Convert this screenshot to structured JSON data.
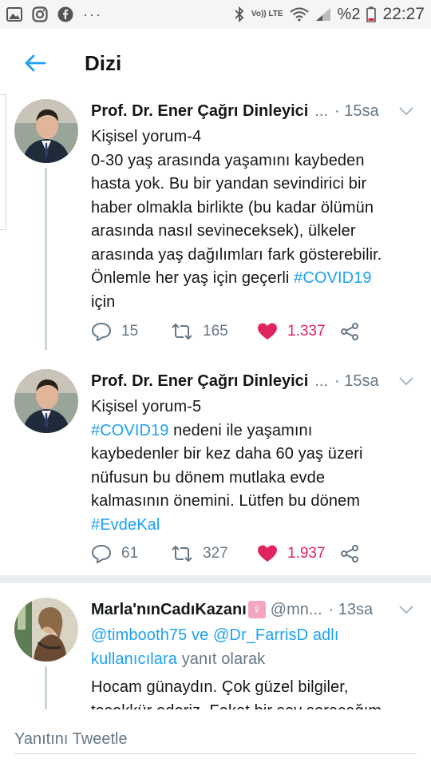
{
  "status_bar": {
    "icons_left": [
      "gallery-icon",
      "instagram-icon",
      "facebook-icon"
    ],
    "more": "···",
    "volte": "Vo)) LTE",
    "battery_pct": "%2",
    "time": "22:27"
  },
  "header": {
    "title": "Dizi"
  },
  "tweets": [
    {
      "author": "Prof. Dr. Ener Çağrı Dinleyici",
      "ellipsis": "...",
      "time": "· 15sa",
      "lines": [
        "Kişisel yorum-4",
        "0-30 yaş arasında yaşamını kaybeden",
        "hasta yok. Bu bir yandan sevindirici bir",
        "haber olmakla birlikte (bu kadar ölümün",
        "arasında nasıl sevineceksek), ülkeler",
        "arasında yaş dağılımları fark gösterebilir.",
        "Önlemle her yaş için geçerli "
      ],
      "hashtag": "#COVID19",
      "last_line": "için",
      "replies": "15",
      "retweets": "165",
      "likes": "1.337"
    },
    {
      "author": "Prof. Dr. Ener Çağrı Dinleyici",
      "ellipsis": "...",
      "time": "· 15sa",
      "line1": "Kişisel yorum-5",
      "hashtag1": "#COVID19",
      "line2_rest": " nedeni ile yaşamını",
      "line3": "kaybedenler bir kez daha 60 yaş üzeri",
      "line4": "nüfusun bu dönem mutlaka evde",
      "line5": "kalmasının önemini. Lütfen bu dönem",
      "hashtag2": "#EvdeKal",
      "replies": "61",
      "retweets": "327",
      "likes": "1.937"
    },
    {
      "author": "Marla'nınCadıKazanı",
      "emoji": "♀",
      "handle": "@mn...",
      "time": "· 13sa",
      "mention1": "@timbooth75",
      "joiner": " ve ",
      "mention2": "@Dr_FarrisD adlı",
      "mention2b": "kullanıcılara",
      "reply_suffix": " yanıt olarak",
      "line1": "Hocam günaydın. Çok güzel bilgiler,",
      "line2": "teşekkür ederiz. Fakat bir şey soracağım"
    }
  ],
  "reply_bar": {
    "placeholder": "Yanıtını Tweetle"
  },
  "colors": {
    "accent": "#1da1f2",
    "like": "#e0245e",
    "muted": "#657786"
  }
}
